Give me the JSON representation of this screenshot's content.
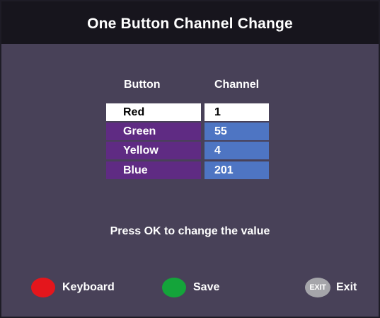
{
  "title": "One Button Channel Change",
  "table": {
    "header_button": "Button",
    "header_channel": "Channel",
    "rows": [
      {
        "button": "Red",
        "channel": "1",
        "selected": true
      },
      {
        "button": "Green",
        "channel": "55"
      },
      {
        "button": "Yellow",
        "channel": "4"
      },
      {
        "button": "Blue",
        "channel": "201"
      }
    ]
  },
  "hint": "Press OK to change the value",
  "legend": {
    "keyboard_label": "Keyboard",
    "save_label": "Save",
    "exit_icon_text": "EXIT",
    "exit_label": "Exit"
  },
  "colors": {
    "background": "#484158",
    "title_bar": "#17151d",
    "button_cell": "#5f2b83",
    "channel_cell": "#4e75c3",
    "selected_cell": "#ffffff",
    "red_key": "#e4161c",
    "green_key": "#14a43a",
    "exit_key": "#a5a5aa"
  },
  "icons": {
    "keyboard": "red-circle-icon",
    "save": "green-circle-icon",
    "exit": "exit-key-icon"
  }
}
